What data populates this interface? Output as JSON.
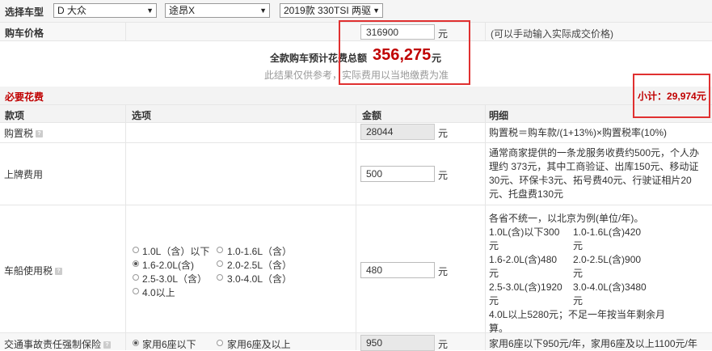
{
  "selector": {
    "label": "选择车型",
    "brand": "D 大众",
    "model": "途昂X",
    "trim": "2019款 330TSI 两驱"
  },
  "price": {
    "label": "购车价格",
    "value": "316900",
    "unit": "元",
    "hint": "(可以手动输入实际成交价格)"
  },
  "summary": {
    "label": "全款购车预计花费总额",
    "total": "356,275",
    "unit": "元",
    "note": "此结果仅供参考，实际费用以当地缴费为准"
  },
  "section": {
    "title": "必要花费",
    "subtotal_label": "小计：",
    "subtotal_value": "29,974元"
  },
  "table": {
    "headers": {
      "item": "款项",
      "option": "选项",
      "amount": "金额",
      "detail": "明细"
    },
    "unit": "元",
    "qm": "?",
    "rows": {
      "purchase_tax": {
        "name": "购置税",
        "amount": "28044",
        "detail": "购置税＝购车款/(1+13%)×购置税率(10%)"
      },
      "plate_fee": {
        "name": "上牌费用",
        "amount": "500",
        "detail_lines": [
          "通常商家提供的一条龙服务收费约500元，个人办",
          "理约 373元，其中工商验证、出库150元、移动证",
          "30元、环保卡3元、拓号费40元、行驶证相片20",
          "元、托盘费130元"
        ]
      },
      "vehicle_tax": {
        "name": "车船使用税",
        "amount": "480",
        "options": [
          "1.0L（含）以下",
          "1.0-1.6L（含）",
          "1.6-2.0L(含)",
          "2.0-2.5L（含）",
          "2.5-3.0L（含）",
          "3.0-4.0L（含）",
          "4.0以上"
        ],
        "selected": "1.6-2.0L(含)",
        "detail": {
          "intro1": "各省不统一，以北京为例(单位/年)。",
          "rows": [
            [
              "1.0L(含)以下300",
              "1.0-1.6L(含)420"
            ],
            [
              "元",
              "元"
            ],
            [
              "1.6-2.0L(含)480",
              "2.0-2.5L(含)900"
            ],
            [
              "元",
              "元"
            ],
            [
              "2.5-3.0L(含)1920",
              "3.0-4.0L(含)3480"
            ],
            [
              "元",
              "元"
            ]
          ],
          "tail1": "4.0L以上5280元；不足一年按当年剩余月",
          "tail2": "算。"
        }
      },
      "insurance": {
        "name": "交通事故责任强制保险",
        "amount": "950",
        "options": [
          "家用6座以下",
          "家用6座及以上"
        ],
        "selected": "家用6座以下",
        "detail": "家用6座以下950元/年，家用6座及以上1100元/年"
      }
    }
  },
  "colors": {
    "accent_red": "#c00000",
    "box_red": "#e03030",
    "row_alt": "#f7f7f7"
  }
}
